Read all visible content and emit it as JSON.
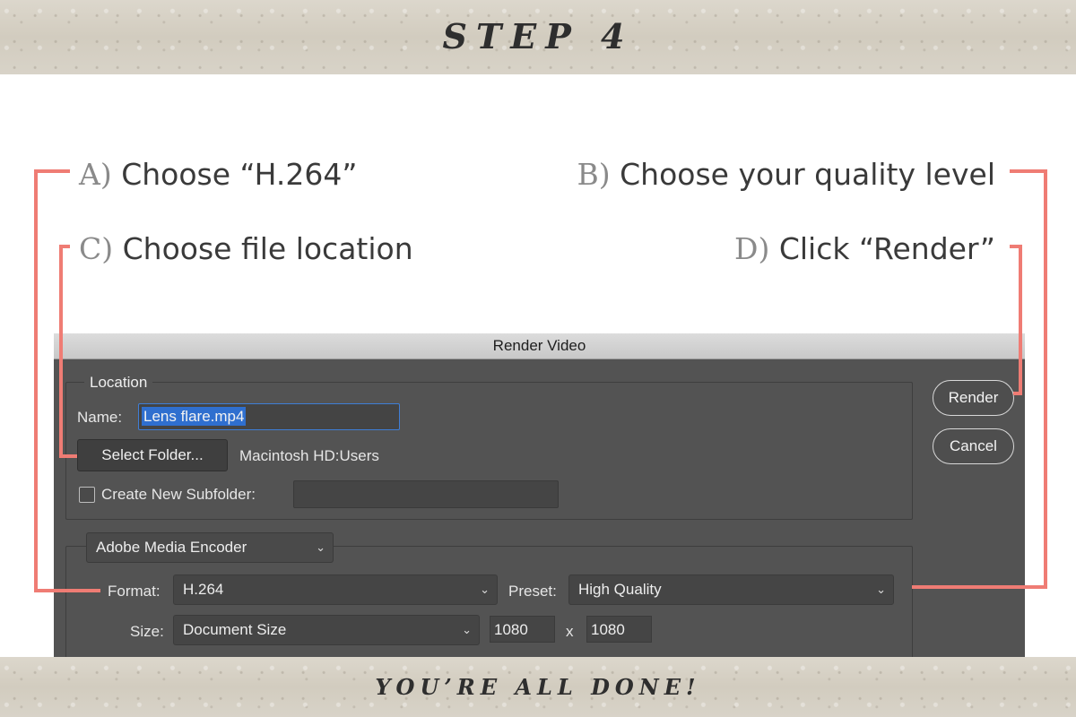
{
  "header": {
    "title": "STEP 4"
  },
  "footer": {
    "text": "YOU’RE ALL DONE!"
  },
  "instructions": [
    {
      "letter": "A)",
      "text": "Choose “H.264”"
    },
    {
      "letter": "B)",
      "text": "Choose your quality level"
    },
    {
      "letter": "C)",
      "text": "Choose file location"
    },
    {
      "letter": "D)",
      "text": "Click “Render”"
    }
  ],
  "dialog": {
    "title": "Render Video",
    "location": {
      "legend": "Location",
      "name_label": "Name:",
      "name_value": "Lens flare.mp4",
      "select_folder_label": "Select Folder...",
      "folder_path": "Macintosh HD:Users",
      "subfolder_label": "Create New Subfolder:",
      "subfolder_value": "",
      "subfolder_checked": false
    },
    "buttons": {
      "render": "Render",
      "cancel": "Cancel"
    },
    "encoder": {
      "selected": "Adobe Media Encoder",
      "format_label": "Format:",
      "format_value": "H.264",
      "preset_label": "Preset:",
      "preset_value": "High Quality",
      "size_label": "Size:",
      "size_value": "Document Size",
      "width": "1080",
      "separator": "x",
      "height": "1080"
    }
  },
  "colors": {
    "accent_line": "#ef7c74",
    "dialog_bg": "#535353",
    "selection": "#2f6fcf"
  },
  "icons": {
    "dropdown": "chevron-down-icon"
  }
}
